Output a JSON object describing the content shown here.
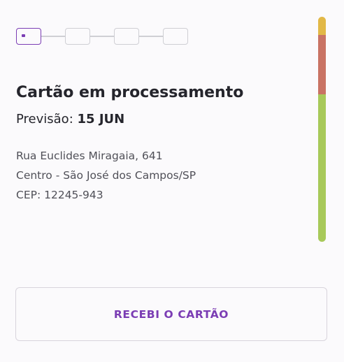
{
  "stepper": {
    "total_steps": 4,
    "current_step": 1
  },
  "status_bar": {
    "colors": {
      "yellow": "#e2b847",
      "red": "#c97364",
      "green": "#a8c95a"
    }
  },
  "card": {
    "title": "Cartão em processamento",
    "forecast_label": "Previsão:",
    "forecast_date": "15 JUN",
    "address": {
      "street": "Rua Euclides Miragaia, 641",
      "district_city": "Centro - São José dos Campos/SP",
      "zip": "CEP: 12245-943"
    }
  },
  "actions": {
    "received_button_label": "RECEBI O CARTÃO"
  },
  "colors": {
    "accent": "#7b3db4",
    "step_inactive": "#cfcfd4",
    "background": "#fbfafc"
  }
}
